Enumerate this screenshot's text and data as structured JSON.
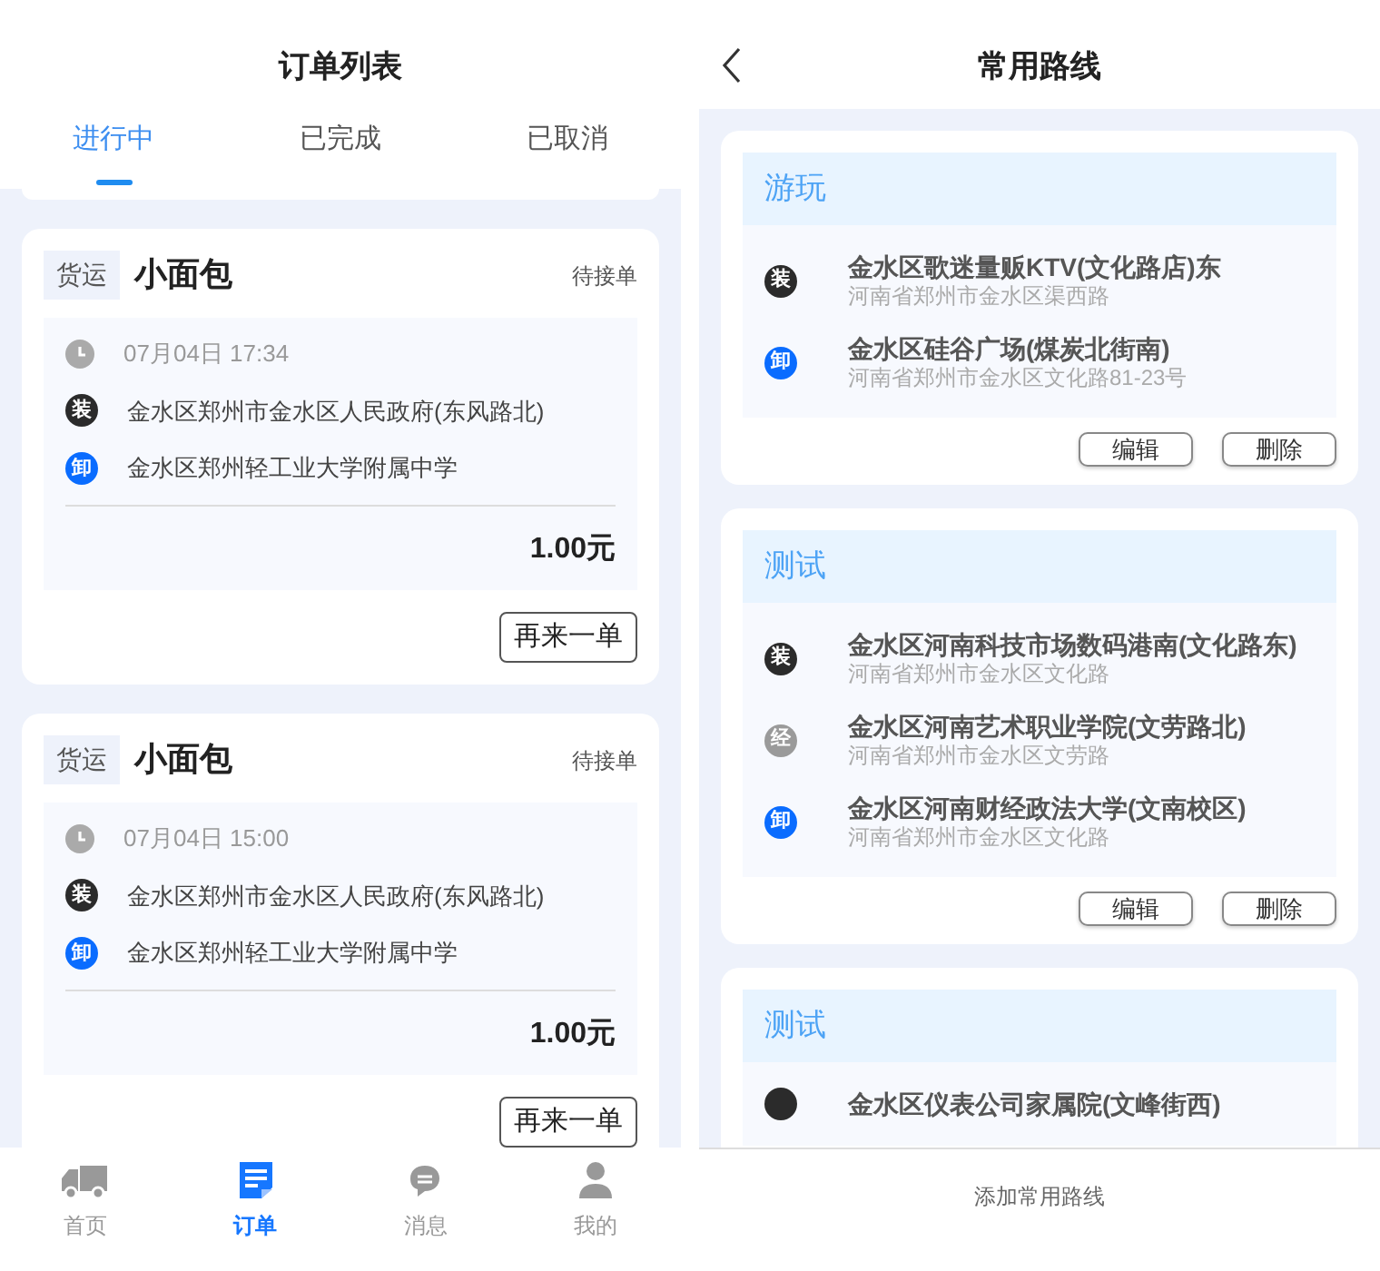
{
  "orders_screen": {
    "title": "订单列表",
    "tabs": [
      {
        "label": "进行中",
        "selected": true
      },
      {
        "label": "已完成",
        "selected": false
      },
      {
        "label": "已取消",
        "selected": false
      }
    ],
    "orders": [
      {
        "tag": "货运",
        "name": "小面包",
        "status": "待接单",
        "time": "07月04日 17:34",
        "stops": [
          {
            "kind": "load",
            "badge": "装",
            "address": "金水区郑州市金水区人民政府(东风路北)"
          },
          {
            "kind": "unload",
            "badge": "卸",
            "address": "金水区郑州轻工业大学附属中学"
          }
        ],
        "price": "1.00元",
        "button": "再来一单"
      },
      {
        "tag": "货运",
        "name": "小面包",
        "status": "待接单",
        "time": "07月04日 15:00",
        "stops": [
          {
            "kind": "load",
            "badge": "装",
            "address": "金水区郑州市金水区人民政府(东风路北)"
          },
          {
            "kind": "unload",
            "badge": "卸",
            "address": "金水区郑州轻工业大学附属中学"
          }
        ],
        "price": "1.00元",
        "button": "再来一单"
      }
    ],
    "nav": [
      {
        "label": "首页",
        "kind": "truck",
        "selected": false
      },
      {
        "label": "订单",
        "kind": "document",
        "selected": true
      },
      {
        "label": "消息",
        "kind": "chat",
        "selected": false
      },
      {
        "label": "我的",
        "kind": "person",
        "selected": false
      }
    ]
  },
  "routes_screen": {
    "title": "常用路线",
    "routes": [
      {
        "name": "游玩",
        "stops": [
          {
            "kind": "load",
            "badge": "装",
            "name": "金水区歌迷量贩KTV(文化路店)东",
            "address": "河南省郑州市金水区渠西路"
          },
          {
            "kind": "unload",
            "badge": "卸",
            "name": "金水区硅谷广场(煤炭北街南)",
            "address": "河南省郑州市金水区文化路81-23号"
          }
        ],
        "buttons": [
          "编辑",
          "删除"
        ]
      },
      {
        "name": "测试",
        "stops": [
          {
            "kind": "load",
            "badge": "装",
            "name": "金水区河南科技市场数码港南(文化路东)",
            "address": "河南省郑州市金水区文化路"
          },
          {
            "kind": "via",
            "badge": "经",
            "name": "金水区河南艺术职业学院(文劳路北)",
            "address": "河南省郑州市金水区文劳路"
          },
          {
            "kind": "unload",
            "badge": "卸",
            "name": "金水区河南财经政法大学(文南校区)",
            "address": "河南省郑州市金水区文化路"
          }
        ],
        "buttons": [
          "编辑",
          "删除"
        ]
      },
      {
        "name": "测试",
        "stops": [
          {
            "kind": "load",
            "name": "金水区仪表公司家属院(文峰街西)"
          }
        ]
      }
    ],
    "footer_button": "添加常用路线"
  }
}
